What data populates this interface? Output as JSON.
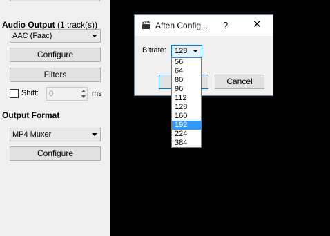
{
  "audio_output": {
    "heading": "Audio Output",
    "track_count": "(1 track(s))",
    "codec_selected": "AAC (Faac)",
    "configure_label": "Configure",
    "filters_label": "Filters",
    "shift_label": "Shift:",
    "shift_value": "0",
    "shift_unit": "ms"
  },
  "output_format": {
    "heading": "Output Format",
    "muxer_selected": "MP4 Muxer",
    "configure_label": "Configure"
  },
  "dialog": {
    "title": "Aften Config...",
    "help": "?",
    "close": "✕",
    "bitrate_label": "Bitrate:",
    "bitrate_value": "128",
    "cancel_label": "Cancel",
    "bitrate_options": [
      "56",
      "64",
      "80",
      "96",
      "112",
      "128",
      "160",
      "192",
      "224",
      "384"
    ],
    "highlighted_option": "192"
  }
}
